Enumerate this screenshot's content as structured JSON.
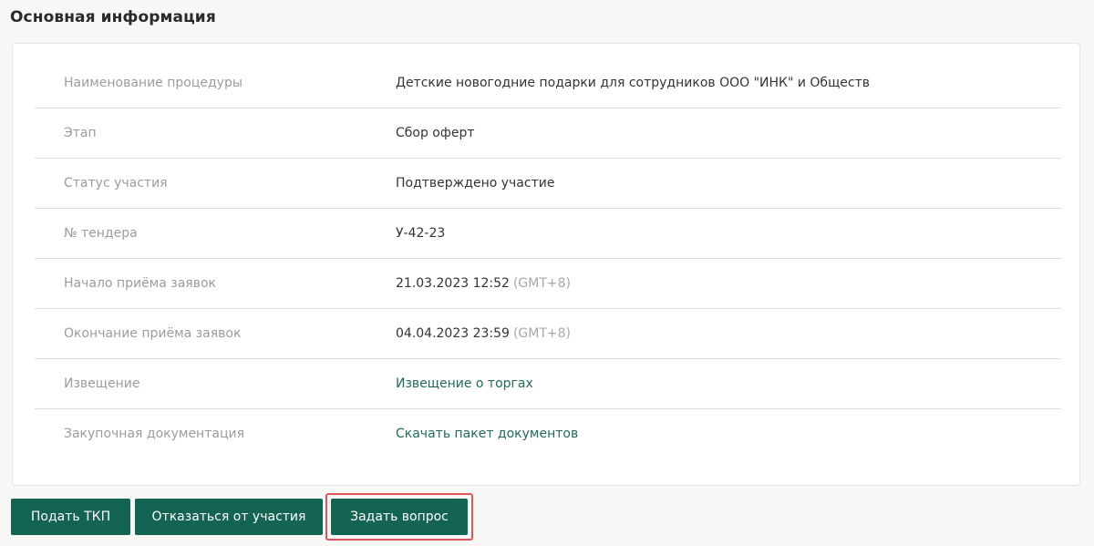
{
  "section": {
    "title": "Основная информация"
  },
  "rows": [
    {
      "label": "Наименование процедуры",
      "value": "Детские новогодние подарки для сотрудников ООО \"ИНК\" и Обществ"
    },
    {
      "label": "Этап",
      "value": "Сбор оферт"
    },
    {
      "label": "Статус участия",
      "value": "Подтверждено участие"
    },
    {
      "label": "№ тендера",
      "value": "У-42-23"
    },
    {
      "label": "Начало приёма заявок",
      "value": "21.03.2023 12:52",
      "tz": "(GMT+8)"
    },
    {
      "label": "Окончание приёма заявок",
      "value": "04.04.2023 23:59",
      "tz": "(GMT+8)"
    },
    {
      "label": "Извещение",
      "link": "Извещение о торгах"
    },
    {
      "label": "Закупочная документация",
      "link": "Скачать пакет документов"
    }
  ],
  "actions": {
    "submit_label": "Подать ТКП",
    "decline_label": "Отказаться от участия",
    "question_label": "Задать вопрос"
  },
  "colors": {
    "primary": "#136452",
    "link": "#1f6b58",
    "highlight": "#e0545a"
  }
}
